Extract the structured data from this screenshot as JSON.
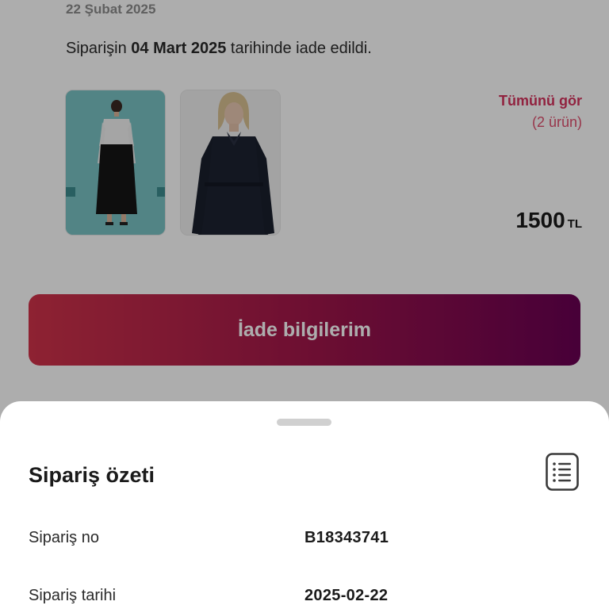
{
  "order": {
    "date": "22 Şubat 2025",
    "message_prefix": "Siparişin ",
    "message_date": "04 Mart 2025",
    "message_suffix": " tarihinde iade edildi.",
    "see_all_label": "Tümünü gör",
    "see_all_count": "(2 ürün)",
    "price_value": "1500",
    "price_currency": "TL",
    "return_button_label": "İade bilgilerim",
    "colors": {
      "accent": "#d6335e",
      "button_gradient_start": "#d1334a",
      "button_gradient_end": "#6a0053"
    }
  },
  "products": [
    {
      "name": "product-thumb-white-shirt-black-skirt"
    },
    {
      "name": "product-thumb-navy-trench-dress"
    }
  ],
  "summary": {
    "title": "Sipariş özeti",
    "icon": "list-icon",
    "rows": [
      {
        "label": "Sipariş no",
        "value": "B18343741"
      },
      {
        "label": "Sipariş tarihi",
        "value": "2025-02-22"
      }
    ]
  }
}
